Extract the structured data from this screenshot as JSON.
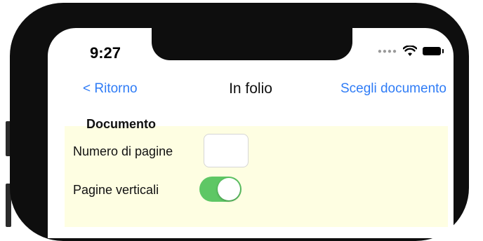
{
  "status_bar": {
    "time": "9:27",
    "icons": [
      "signal-dots-icon",
      "wifi-icon",
      "battery-icon"
    ]
  },
  "nav": {
    "back_label": "< Ritorno",
    "title": "In folio",
    "action_label": "Scegli documento"
  },
  "form": {
    "section_title": "Documento",
    "pages_label": "Numero di pagine",
    "pages_value": "",
    "vertical_label": "Pagine verticali",
    "vertical_on": true
  },
  "colors": {
    "accent": "#2f7cf6",
    "panel_bg": "#fefee2",
    "toggle_on": "#5ec765",
    "device_frame": "#0e0e0e"
  }
}
